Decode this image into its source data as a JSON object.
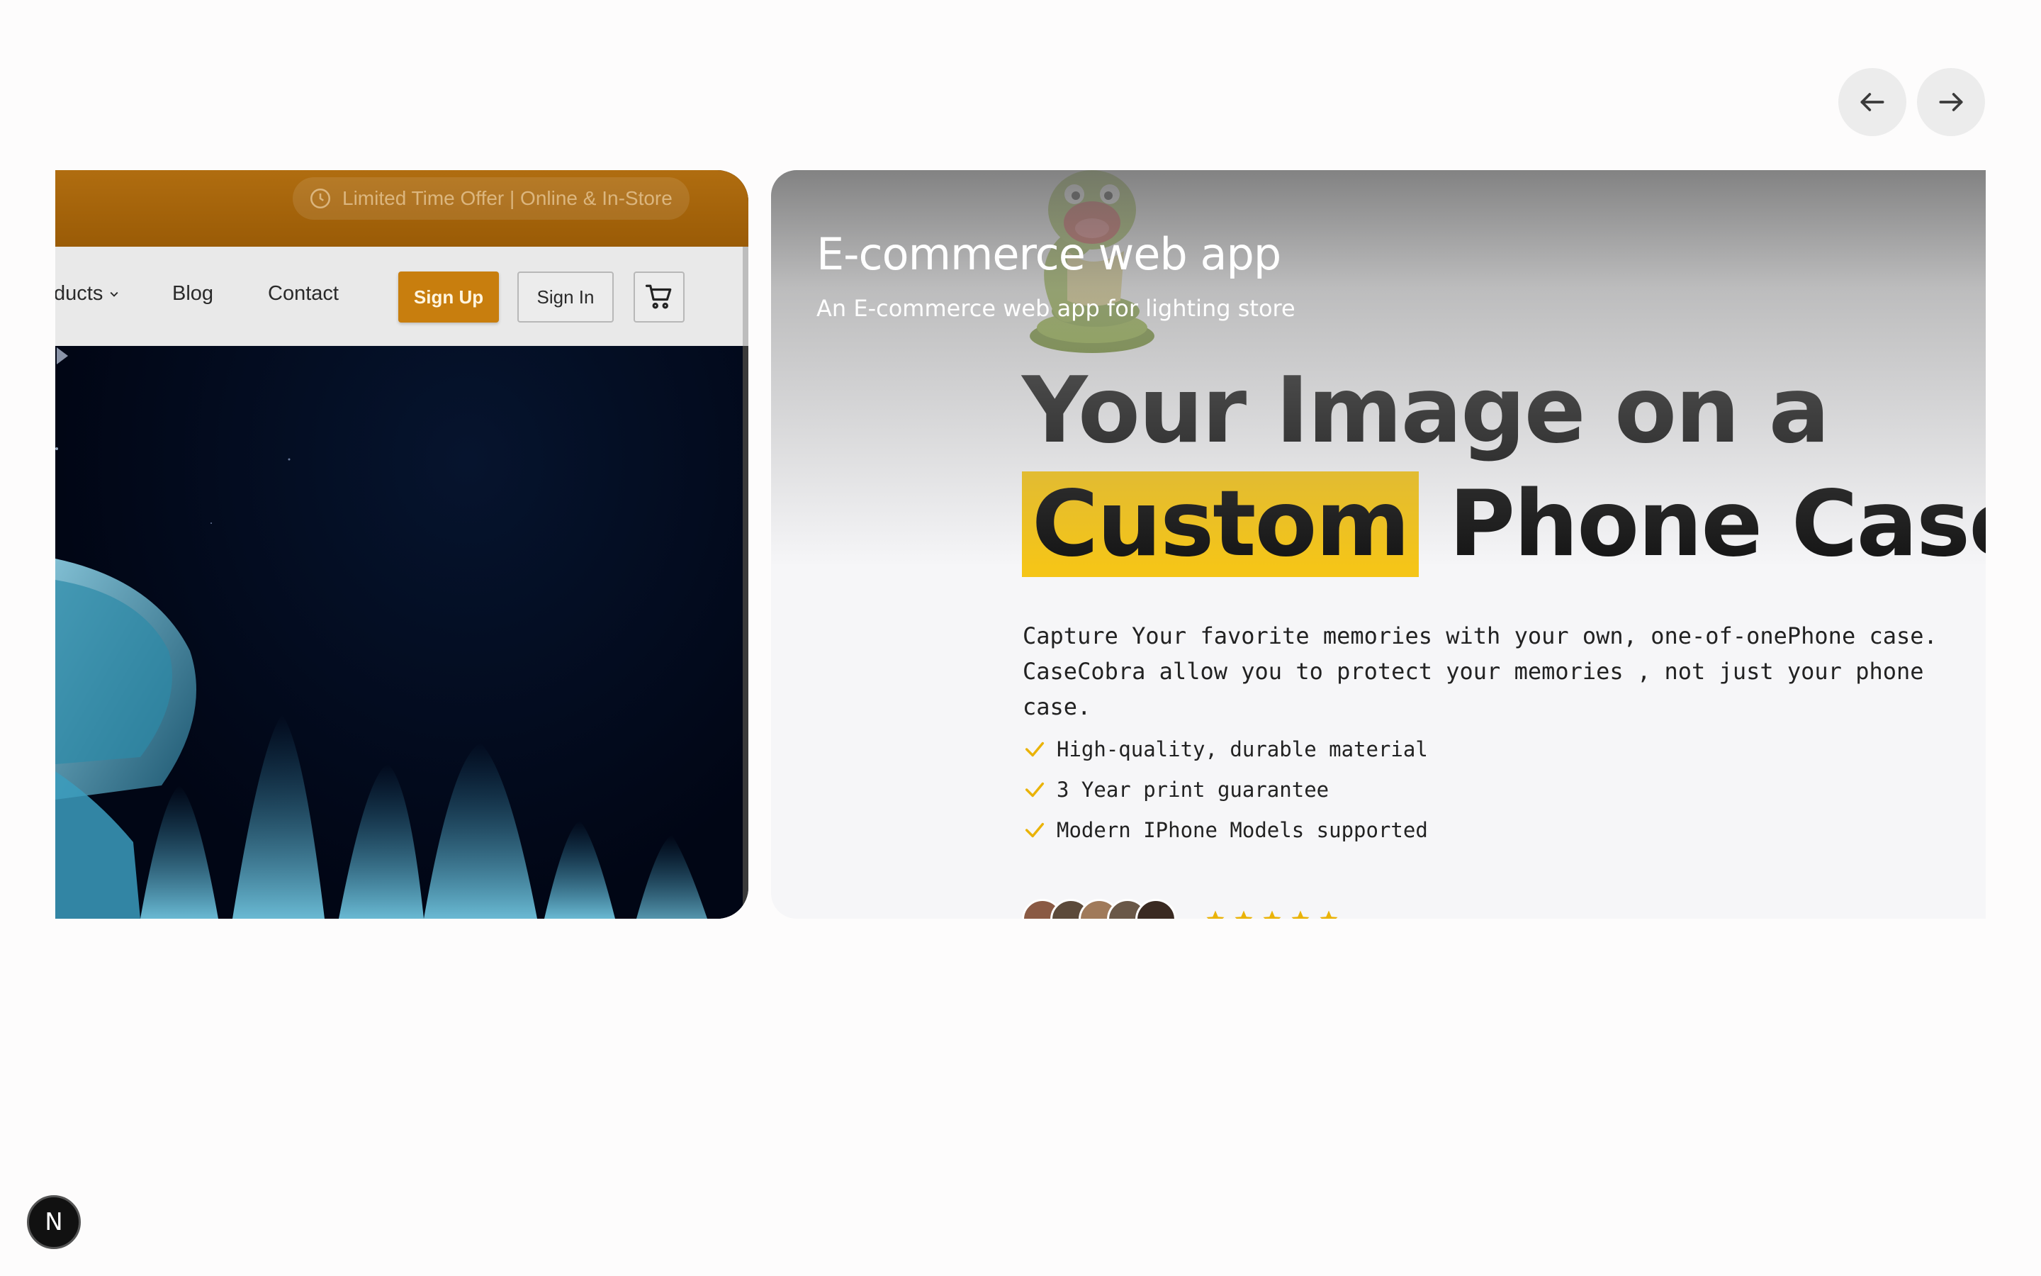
{
  "carousel": {
    "prev_icon": "arrow-left-icon",
    "next_icon": "arrow-right-icon"
  },
  "left_card": {
    "promo_text": "Limited Time Offer | Online & In-Store",
    "nav": {
      "products_label": "ducts",
      "blog_label": "Blog",
      "contact_label": "Contact",
      "signup_label": "Sign Up",
      "signin_label": "Sign In"
    },
    "accent_color": "#c87e0e"
  },
  "right_card": {
    "title": "E-commerce web app",
    "subtitle": "An E-commerce web app for lighting store",
    "headline_line1": "Your Image on a",
    "headline_highlight": "Custom",
    "headline_rest": " Phone Case",
    "description_line1": "Capture Your favorite memories with your own, one-of-onePhone case.",
    "description_line2": "CaseCobra allow you to protect your memories , not just your phone case.",
    "features": [
      "High-quality, durable material",
      "3 Year print guarantee",
      "Modern IPhone Models supported"
    ],
    "highlight_color": "#f5c518",
    "rating_stars": 5
  },
  "badge": {
    "label": "N"
  }
}
